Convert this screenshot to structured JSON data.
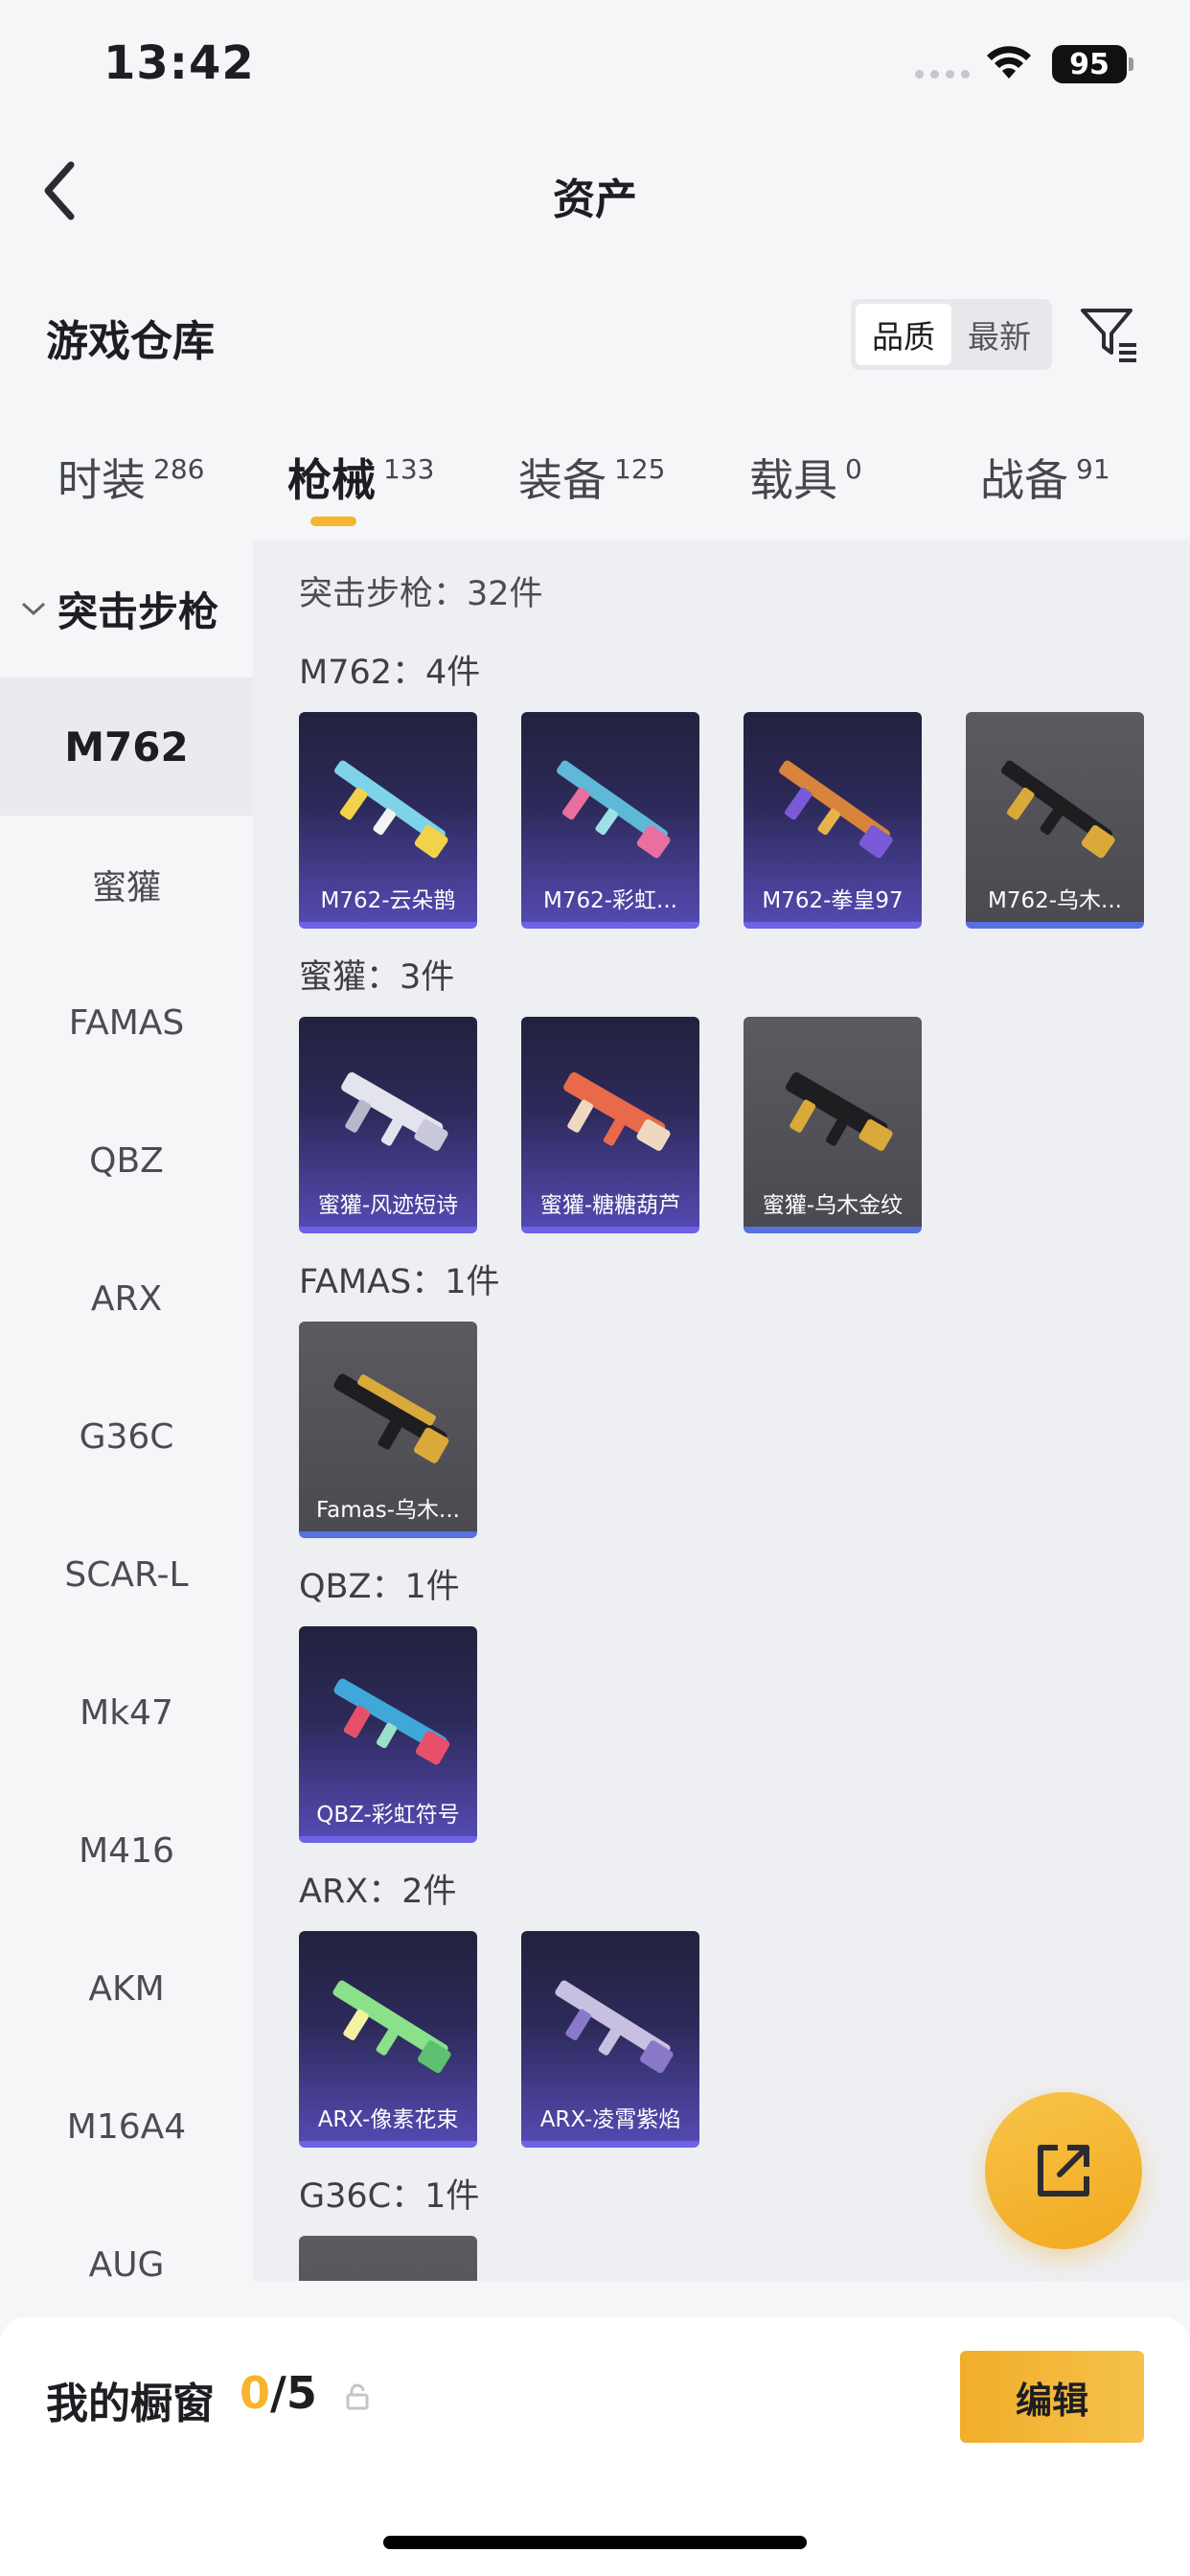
{
  "status_bar": {
    "time": "13:42",
    "battery": "95"
  },
  "nav": {
    "title": "资产"
  },
  "warehouse": {
    "title": "游戏仓库",
    "sort_options": [
      "品质",
      "最新"
    ]
  },
  "tabs": [
    {
      "label": "时装",
      "count": "286"
    },
    {
      "label": "枪械",
      "count": "133"
    },
    {
      "label": "装备",
      "count": "125"
    },
    {
      "label": "载具",
      "count": "0"
    },
    {
      "label": "战备",
      "count": "91"
    }
  ],
  "sidebar": {
    "category": "突击步枪",
    "items": [
      "M762",
      "蜜獾",
      "FAMAS",
      "QBZ",
      "ARX",
      "G36C",
      "SCAR-L",
      "Mk47",
      "M416",
      "AKM",
      "M16A4",
      "AUG"
    ]
  },
  "content": {
    "section_count": "突击步枪：32件",
    "groups": [
      {
        "label": "M762：4件",
        "cards": [
          {
            "name": "M762-云朵鹊",
            "rarity": "purple"
          },
          {
            "name": "M762-彩虹...",
            "rarity": "purple"
          },
          {
            "name": "M762-拳皇97",
            "rarity": "purple"
          },
          {
            "name": "M762-乌木...",
            "rarity": "gray"
          }
        ]
      },
      {
        "label": "蜜獾：3件",
        "cards": [
          {
            "name": "蜜獾-风迹短诗",
            "rarity": "purple"
          },
          {
            "name": "蜜獾-糖糖葫芦",
            "rarity": "purple"
          },
          {
            "name": "蜜獾-乌木金纹",
            "rarity": "gray"
          }
        ]
      },
      {
        "label": "FAMAS：1件",
        "cards": [
          {
            "name": "Famas-乌木...",
            "rarity": "gray"
          }
        ]
      },
      {
        "label": "QBZ：1件",
        "cards": [
          {
            "name": "QBZ-彩虹符号",
            "rarity": "purple"
          }
        ]
      },
      {
        "label": "ARX：2件",
        "cards": [
          {
            "name": "ARX-像素花束",
            "rarity": "purple"
          },
          {
            "name": "ARX-凌霄紫焰",
            "rarity": "purple"
          }
        ]
      },
      {
        "label": "G36C：1件",
        "cards": []
      }
    ]
  },
  "showcase": {
    "label": "我的橱窗",
    "current": "0",
    "total": "/5",
    "edit_label": "编辑"
  },
  "colors": {
    "accent": "#f5b52e",
    "purple_rarity": "#6c63e6",
    "gray_rarity": "#5672e0"
  }
}
